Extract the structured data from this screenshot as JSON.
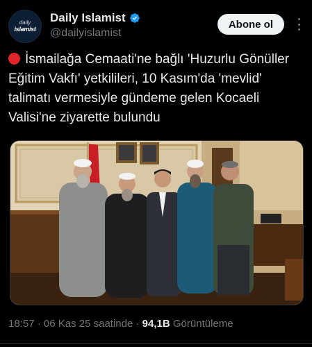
{
  "account": {
    "avatar_line1": "daily",
    "avatar_line2": "islamist",
    "display_name": "Daily Islamist",
    "handle": "@dailyislamist"
  },
  "actions": {
    "follow_label": "Abone ol"
  },
  "tweet": {
    "text": "İsmailağa Cemaati'ne bağlı 'Huzurlu Gönüller Eğitim Vakfı' yetkilileri, 10 Kasım'da 'mevlid' talimatı vermesiyle gündeme gelen Kocaeli Valisi'ne ziyarette bulundu"
  },
  "meta": {
    "time": "18:57",
    "date": "06 Kas 25 saatinde",
    "views_count": "94,1B",
    "views_label": "Görüntüleme"
  },
  "colors": {
    "accent_verified": "#1d9bf0",
    "background": "#000000",
    "follow_button_bg": "#eff3f4"
  }
}
